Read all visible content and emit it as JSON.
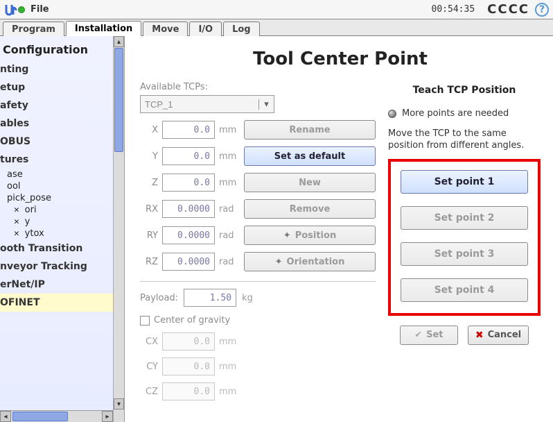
{
  "menubar": {
    "file": "File",
    "time": "00:54:35",
    "cccc": "CCCC"
  },
  "tabs": [
    "Program",
    "Installation",
    "Move",
    "I/O",
    "Log"
  ],
  "active_tab": 1,
  "sidebar": {
    "heading": "Configuration",
    "items": [
      "nting",
      "etup",
      "afety",
      "ables",
      "OBUS",
      "tures"
    ],
    "subs": [
      "ase",
      "ool",
      "pick_pose"
    ],
    "sub2": [
      "ori",
      "y",
      "ytox"
    ],
    "items2": [
      "ooth Transition",
      "nveyor Tracking",
      "erNet/IP",
      "OFINET"
    ]
  },
  "page": {
    "title": "Tool Center Point",
    "available_label": "Available TCPs:",
    "tcp_name": "TCP_1",
    "coords": {
      "X": {
        "val": "0.0",
        "unit": "mm"
      },
      "Y": {
        "val": "0.0",
        "unit": "mm"
      },
      "Z": {
        "val": "0.0",
        "unit": "mm"
      },
      "RX": {
        "val": "0.0000",
        "unit": "rad"
      },
      "RY": {
        "val": "0.0000",
        "unit": "rad"
      },
      "RZ": {
        "val": "0.0000",
        "unit": "rad"
      }
    },
    "buttons": {
      "rename": "Rename",
      "default": "Set as default",
      "new": "New",
      "remove": "Remove",
      "position": "Position",
      "orientation": "Orientation"
    },
    "payload_label": "Payload:",
    "payload_val": "1.50",
    "payload_unit": "kg",
    "cog_label": "Center of gravity",
    "cog": {
      "CX": {
        "val": "0.0",
        "unit": "mm"
      },
      "CY": {
        "val": "0.0",
        "unit": "mm"
      },
      "CZ": {
        "val": "0.0",
        "unit": "mm"
      }
    },
    "teach": {
      "title": "Teach TCP Position",
      "status": "More points are needed",
      "instr": "Move the TCP to the same position from different angles.",
      "points": [
        "Set point 1",
        "Set point 2",
        "Set point 3",
        "Set point 4"
      ],
      "set": "Set",
      "cancel": "Cancel"
    }
  }
}
